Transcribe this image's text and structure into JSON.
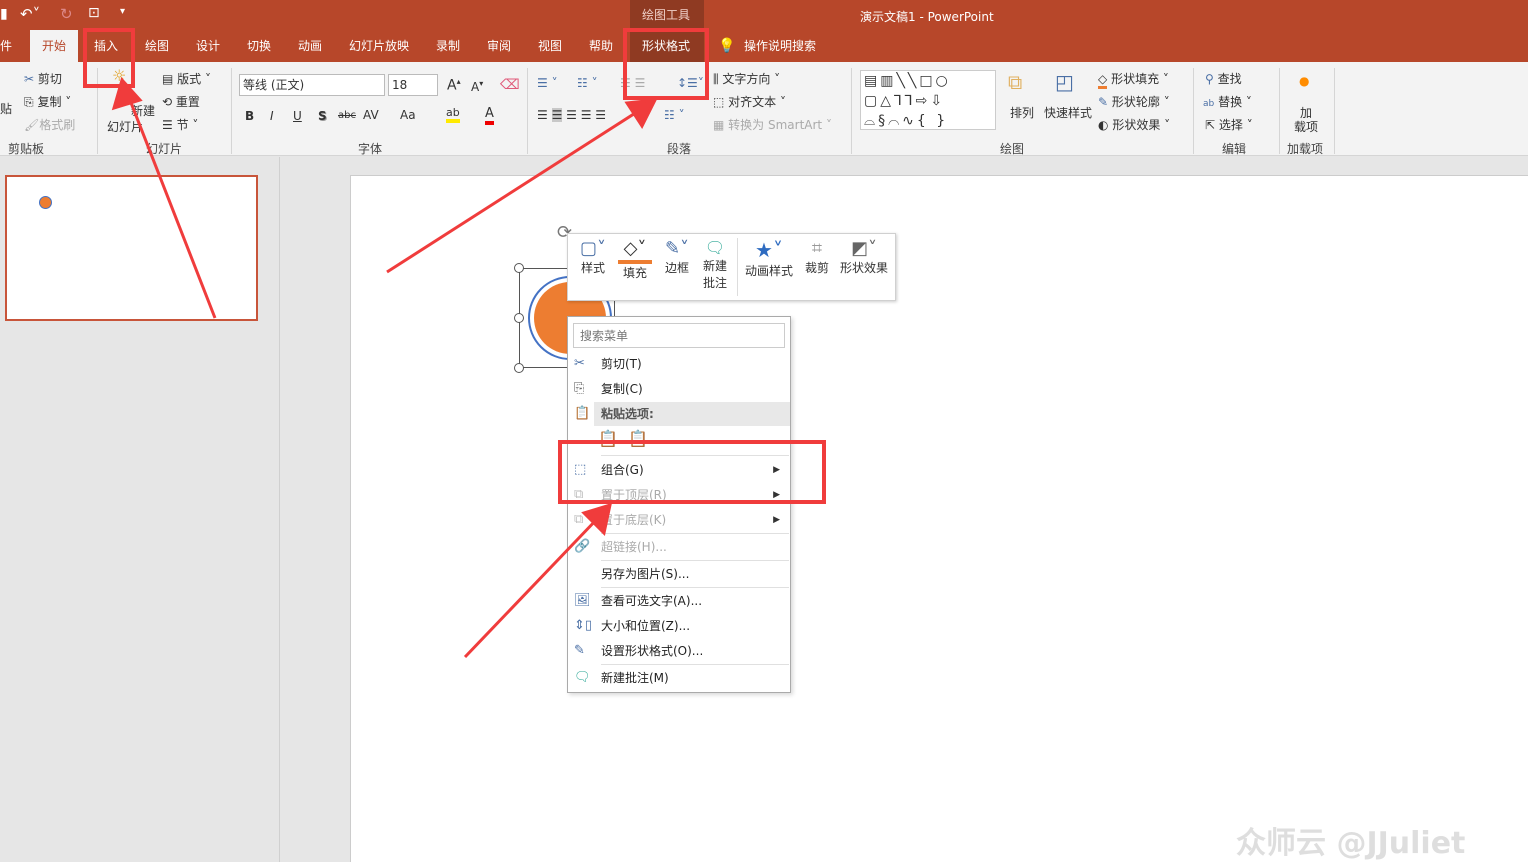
{
  "titlebar": {
    "context_group": "绘图工具",
    "doc_title": "演示文稿1  -  PowerPoint"
  },
  "tabs": [
    {
      "label": "件"
    },
    {
      "label": "开始"
    },
    {
      "label": "插入"
    },
    {
      "label": "绘图"
    },
    {
      "label": "设计"
    },
    {
      "label": "切换"
    },
    {
      "label": "动画"
    },
    {
      "label": "幻灯片放映"
    },
    {
      "label": "录制"
    },
    {
      "label": "审阅"
    },
    {
      "label": "视图"
    },
    {
      "label": "帮助"
    },
    {
      "label": "形状格式"
    },
    {
      "label": "操作说明搜索"
    }
  ],
  "ribbon": {
    "clipboard": {
      "paste": "贴",
      "cut": "剪切",
      "copy": "复制",
      "format_painter": "格式刷",
      "group": "剪贴板"
    },
    "slides": {
      "new_slide": "新建",
      "new_slide2": "幻灯片",
      "layout": "版式",
      "reset": "重置",
      "section": "节",
      "group": "幻灯片"
    },
    "font": {
      "font_name": "等线 (正文)",
      "font_size": "18",
      "bold": "B",
      "italic": "I",
      "underline": "U",
      "shadow": "S",
      "strike": "abc",
      "spacing": "AV",
      "case": "Aa",
      "group": "字体"
    },
    "paragraph": {
      "text_direction": "文字方向",
      "align_text": "对齐文本",
      "smartart": "转换为 SmartArt",
      "group": "段落"
    },
    "drawing": {
      "arrange": "排列",
      "quick_styles": "快速样式",
      "shape_fill": "形状填充",
      "shape_outline": "形状轮廓",
      "shape_effects": "形状效果",
      "group": "绘图"
    },
    "editing": {
      "find": "查找",
      "replace": "替换",
      "select": "选择",
      "group": "编辑"
    },
    "addins": {
      "label1": "加",
      "label2": "载项",
      "group": "加载项"
    }
  },
  "mini_toolbar": {
    "style": "样式",
    "fill": "填充",
    "border": "边框",
    "new_comment1": "新建",
    "new_comment2": "批注",
    "animation": "动画样式",
    "crop": "裁剪",
    "effects": "形状效果"
  },
  "context_menu": {
    "search_placeholder": "搜索菜单",
    "items": [
      {
        "label": "剪切(T)"
      },
      {
        "label": "复制(C)"
      },
      {
        "label": "粘贴选项:"
      },
      {
        "label": "组合(G)"
      },
      {
        "label": "置于顶层(R)"
      },
      {
        "label": "置于底层(K)"
      },
      {
        "label": "超链接(H)..."
      },
      {
        "label": "另存为图片(S)..."
      },
      {
        "label": "查看可选文字(A)..."
      },
      {
        "label": "大小和位置(Z)..."
      },
      {
        "label": "设置形状格式(O)..."
      },
      {
        "label": "新建批注(M)"
      }
    ]
  },
  "watermark": "众师云 @JJuliet",
  "colors": {
    "accent": "#b7472a",
    "shape_fill": "#ed7d31",
    "annotation": "#f03c3c"
  }
}
